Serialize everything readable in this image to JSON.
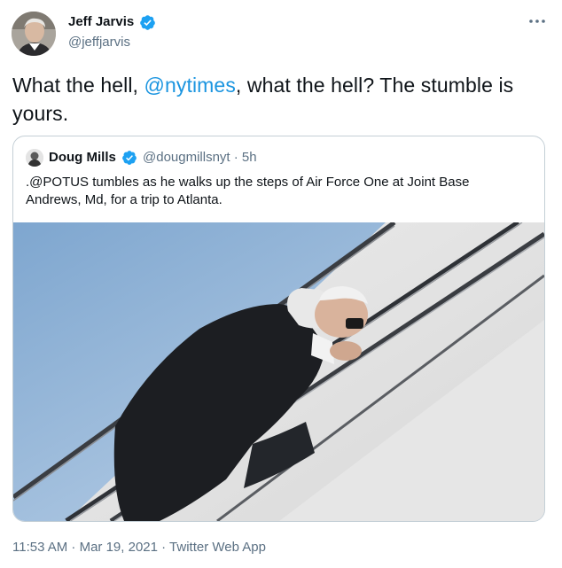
{
  "tweet": {
    "author_name": "Jeff Jarvis",
    "handle": "@jeffjarvis",
    "text_before": "What the hell, ",
    "mention": "@nytimes",
    "text_after": ", what the hell? The stumble is yours.",
    "timestamp": "11:53 AM · Mar 19, 2021 · Twitter Web App"
  },
  "quoted": {
    "author_name": "Doug Mills",
    "handle_time": "@dougmillsnyt · 5h",
    "text": ".@POTUS tumbles as he walks up the steps of Air Force One at Joint Base Andrews, Md, for a trip to Atlanta."
  },
  "colors": {
    "accent": "#1b95e0",
    "verified": "#1da1f2",
    "secondary_text": "#5b7083",
    "border": "#c4cfd6"
  },
  "icons": {
    "verified": "verified-badge-icon",
    "more": "more-options-icon"
  }
}
